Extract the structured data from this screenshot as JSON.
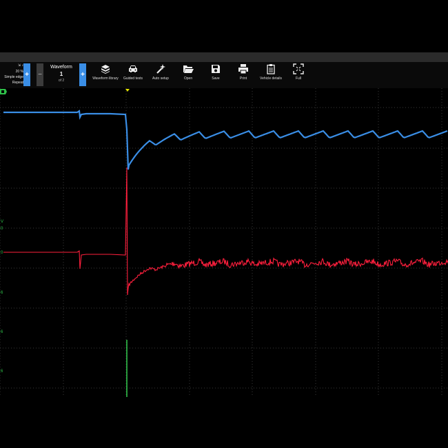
{
  "trigger": {
    "level": "20 %",
    "mode": "Simple edge",
    "repeat": "Repeat"
  },
  "waveform": {
    "title": "Waveform",
    "number": "1",
    "of": "of 2",
    "minus": "−",
    "plus": "+"
  },
  "trigger_plus": "+",
  "tools": [
    {
      "label": "Waveform library",
      "icon": "book-icon"
    },
    {
      "label": "Guided tests",
      "icon": "car-icon"
    },
    {
      "label": "Auto setup",
      "icon": "wand-icon"
    },
    {
      "label": "Open",
      "icon": "folder-icon"
    },
    {
      "label": "Save",
      "icon": "floppy-icon"
    },
    {
      "label": "Print",
      "icon": "printer-icon"
    },
    {
      "label": "Vehicle details",
      "icon": "clipboard-icon"
    },
    {
      "label": "Full",
      "icon": "fullscreen-icon"
    }
  ],
  "axis_labels": {
    "v": "V",
    "zero": "0",
    "a": "0",
    "b": "6",
    "c": "6",
    "d": "6"
  },
  "colors": {
    "channel_a": "#3a8ee6",
    "channel_b": "#ff1f3d",
    "channel_c": "#2fc14a",
    "grid": "#3a3a3a",
    "accent": "#3a8ee6"
  }
}
